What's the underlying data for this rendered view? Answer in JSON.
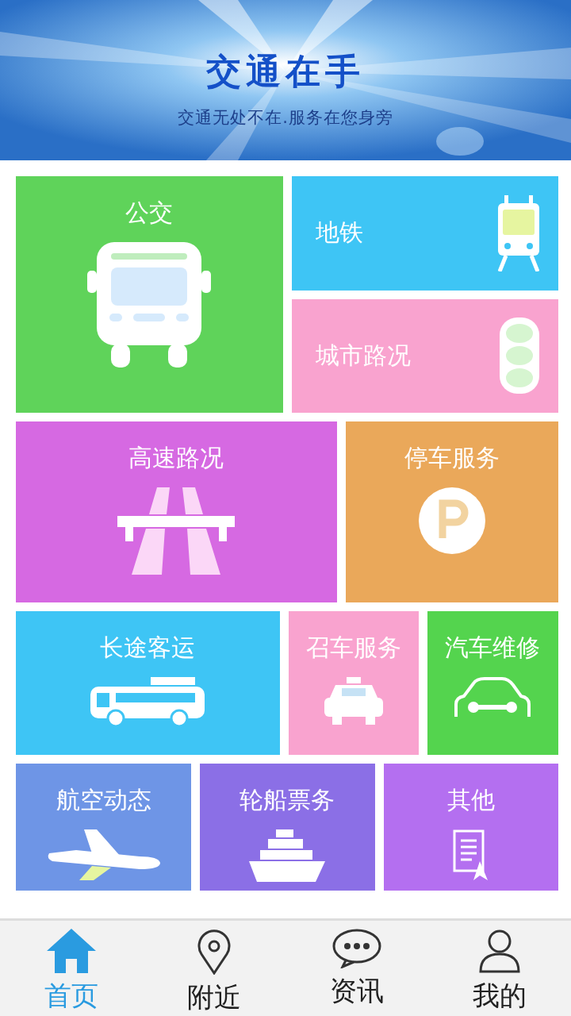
{
  "banner": {
    "title": "交通在手",
    "subtitle": "交通无处不在.服务在您身旁"
  },
  "rows": [
    {
      "tiles": [
        {
          "label": "公交",
          "color": "#5fd35a",
          "kind": "stack"
        },
        {
          "kind": "column",
          "tiles": [
            {
              "label": "地铁",
              "color": "#3ec5f5",
              "kind": "side"
            },
            {
              "label": "城市路况",
              "color": "#f9a3cf",
              "kind": "side"
            }
          ]
        }
      ]
    },
    {
      "tiles": [
        {
          "label": "高速路况",
          "color": "#d669e2",
          "kind": "stack"
        },
        {
          "label": "停车服务",
          "color": "#eaa85a",
          "kind": "stack"
        }
      ]
    },
    {
      "tiles": [
        {
          "label": "长途客运",
          "color": "#3ec5f5",
          "kind": "stack"
        },
        {
          "label": "召车服务",
          "color": "#f9a3cf",
          "kind": "stack"
        },
        {
          "label": "汽车维修",
          "color": "#54d44e",
          "kind": "stack"
        }
      ]
    },
    {
      "tiles": [
        {
          "label": "航空动态",
          "color": "#6e95e6",
          "kind": "stack"
        },
        {
          "label": "轮船票务",
          "color": "#8b6fe6",
          "kind": "stack"
        },
        {
          "label": "其他",
          "color": "#b46ff0",
          "kind": "stack"
        }
      ]
    }
  ],
  "tabs": [
    {
      "label": "首页",
      "selected": true
    },
    {
      "label": "附近",
      "selected": false
    },
    {
      "label": "资讯",
      "selected": false
    },
    {
      "label": "我的",
      "selected": false
    }
  ]
}
